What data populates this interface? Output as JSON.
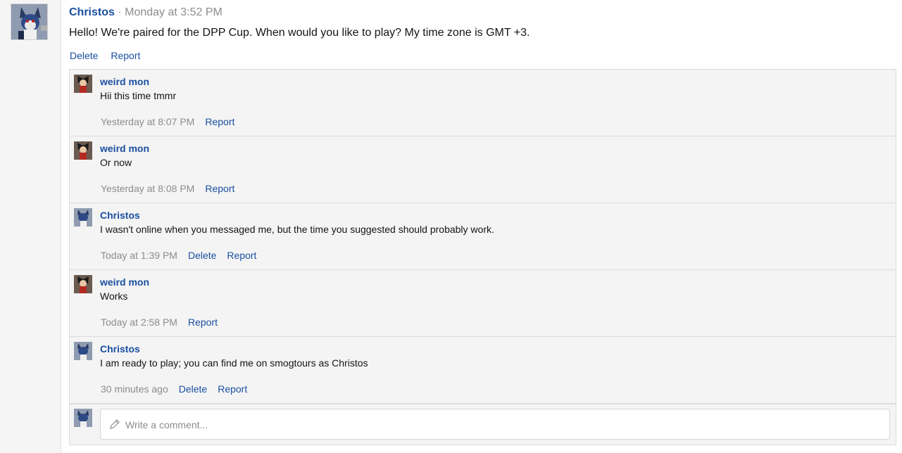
{
  "post": {
    "author": "Christos",
    "meta": " · Monday at 3:52 PM",
    "body": "Hello! We're paired for the DPP Cup. When would you like to play? My time zone is GMT +3.",
    "actions": [
      "Delete",
      "Report"
    ]
  },
  "comments": [
    {
      "author": "weird mon",
      "text": "Hii this time tmmr",
      "time": "Yesterday at 8:07 PM",
      "actions": [
        "Report"
      ],
      "avatar": "weird-mon"
    },
    {
      "author": "weird mon",
      "text": "Or now",
      "time": "Yesterday at 8:08 PM",
      "actions": [
        "Report"
      ],
      "avatar": "weird-mon"
    },
    {
      "author": "Christos",
      "text": "I wasn't online when you messaged me, but the time you suggested should probably work.",
      "time": "Today at 1:39 PM",
      "actions": [
        "Delete",
        "Report"
      ],
      "avatar": "christos"
    },
    {
      "author": "weird mon",
      "text": "Works",
      "time": "Today at 2:58 PM",
      "actions": [
        "Report"
      ],
      "avatar": "weird-mon"
    },
    {
      "author": "Christos",
      "text": "I am ready to play; you can find me on smogtours as Christos",
      "time": "30 minutes ago",
      "actions": [
        "Delete",
        "Report"
      ],
      "avatar": "christos"
    }
  ],
  "reply": {
    "placeholder": "Write a comment..."
  },
  "colors": {
    "link": "#1a4fa0",
    "muted": "#8c8c8c",
    "panel": "#f4f4f4"
  }
}
